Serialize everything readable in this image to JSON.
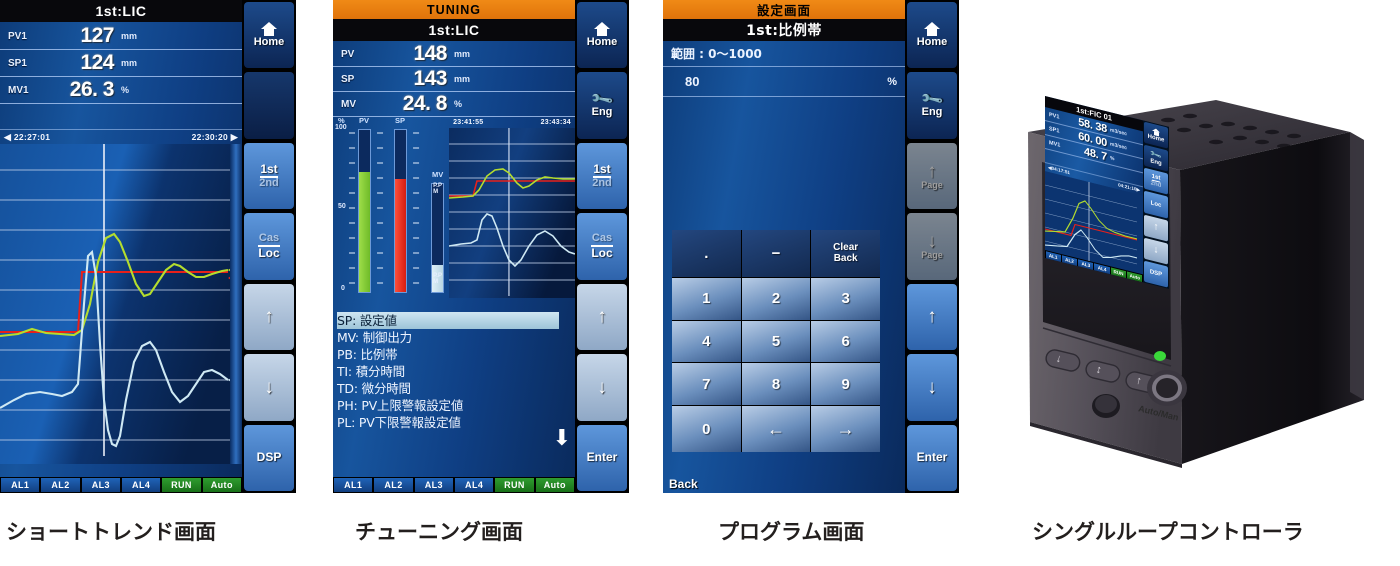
{
  "panels": [
    {
      "caption": "ショートトレンド画面",
      "header": {
        "title": "1st:LIC"
      },
      "values": [
        {
          "tag": "PV1",
          "value": "127",
          "unit": "mm"
        },
        {
          "tag": "SP1",
          "value": "124",
          "unit": "mm"
        },
        {
          "tag": "MV1",
          "value": "26. 3",
          "unit": "%"
        }
      ],
      "trend": {
        "time_start": "22:27:01",
        "time_end": "22:30:20",
        "markers": [
          {
            "label": "PV1",
            "color": "#b4dd2e"
          },
          {
            "label": "SP1",
            "color": "#e8201a"
          },
          {
            "label": "MV1",
            "color": "#cfe9f4"
          }
        ]
      },
      "side_buttons": [
        {
          "id": "home",
          "label": "Home",
          "icon": "house-icon",
          "style": "dark"
        },
        {
          "id": "blank",
          "label": "",
          "style": "blank"
        },
        {
          "id": "loop",
          "label": "1st",
          "sub": "2nd",
          "style": "mid"
        },
        {
          "id": "cascade",
          "label": "Cas",
          "sub": "Loc",
          "style": "mid"
        },
        {
          "id": "up",
          "label": "",
          "icon": "arrow-up-icon",
          "style": "light"
        },
        {
          "id": "down",
          "label": "",
          "icon": "arrow-down-icon",
          "style": "light"
        },
        {
          "id": "dsp",
          "label": "DSP",
          "style": "mid"
        }
      ],
      "status": [
        {
          "label": "AL1",
          "color": "blue"
        },
        {
          "label": "AL2",
          "color": "blue"
        },
        {
          "label": "AL3",
          "color": "blue"
        },
        {
          "label": "AL4",
          "color": "blue"
        },
        {
          "label": "RUN",
          "color": "green"
        },
        {
          "label": "Auto",
          "color": "green"
        }
      ]
    },
    {
      "caption": "チューニング画面",
      "header": {
        "mode": "TUNING",
        "title": "1st:LIC"
      },
      "values": [
        {
          "tag": "PV",
          "value": "148",
          "unit": "mm"
        },
        {
          "tag": "SP",
          "value": "143",
          "unit": "mm"
        },
        {
          "tag": "MV",
          "value": "24. 8",
          "unit": "%"
        }
      ],
      "bargraph": {
        "unit": "%",
        "scale_top": "100",
        "scale_mid": "50",
        "scale_bottom": "0",
        "bars": [
          {
            "label": "PV",
            "pct": 74,
            "color": "green"
          },
          {
            "label": "SP",
            "pct": 70,
            "color": "red"
          },
          {
            "label": "MV",
            "pct": 25,
            "color": "pale"
          }
        ]
      },
      "trend": {
        "time_start": "23:41:55",
        "time_end": "23:43:34"
      },
      "param_list": [
        {
          "code": "SP:",
          "name": "設定値",
          "selected": true
        },
        {
          "code": "MV:",
          "name": "制御出力",
          "selected": false
        },
        {
          "code": "PB:",
          "name": "比例帯",
          "selected": false
        },
        {
          "code": "TI:",
          "name": "積分時間",
          "selected": false
        },
        {
          "code": "TD:",
          "name": "微分時間",
          "selected": false
        },
        {
          "code": "PH:",
          "name": "PV上限警報設定値",
          "selected": false
        },
        {
          "code": "PL:",
          "name": "PV下限警報設定値",
          "selected": false
        }
      ],
      "side_buttons": [
        {
          "id": "home",
          "label": "Home",
          "icon": "house-icon",
          "style": "dark"
        },
        {
          "id": "eng",
          "label": "Eng",
          "icon": "wrench-icon",
          "style": "dark"
        },
        {
          "id": "loop",
          "label": "1st",
          "sub": "2nd",
          "style": "mid"
        },
        {
          "id": "cascade",
          "label": "Cas",
          "sub": "Loc",
          "style": "mid"
        },
        {
          "id": "up",
          "label": "",
          "icon": "arrow-up-icon",
          "style": "light"
        },
        {
          "id": "down",
          "label": "",
          "icon": "arrow-down-icon",
          "style": "light"
        },
        {
          "id": "enter",
          "label": "Enter",
          "style": "mid"
        }
      ],
      "status": [
        {
          "label": "AL1",
          "color": "blue"
        },
        {
          "label": "AL2",
          "color": "blue"
        },
        {
          "label": "AL3",
          "color": "blue"
        },
        {
          "label": "AL4",
          "color": "blue"
        },
        {
          "label": "RUN",
          "color": "green"
        },
        {
          "label": "Auto",
          "color": "green"
        }
      ]
    },
    {
      "caption": "プログラム画面",
      "header": {
        "mode": "設定画面",
        "title": "1st:比例帯"
      },
      "range_label": "範囲 : 0〜1000",
      "entry": {
        "value": "80",
        "unit": "%"
      },
      "keypad": [
        {
          "label": ".",
          "style": "dark"
        },
        {
          "label": "−",
          "style": "dark"
        },
        {
          "label": "Clear\nBack",
          "style": "dark",
          "small": true
        },
        {
          "label": "1",
          "style": "light"
        },
        {
          "label": "2",
          "style": "light"
        },
        {
          "label": "3",
          "style": "light"
        },
        {
          "label": "4",
          "style": "light"
        },
        {
          "label": "5",
          "style": "light"
        },
        {
          "label": "6",
          "style": "light"
        },
        {
          "label": "7",
          "style": "light"
        },
        {
          "label": "8",
          "style": "light"
        },
        {
          "label": "9",
          "style": "light"
        },
        {
          "label": "0",
          "style": "light"
        },
        {
          "label": "←",
          "style": "light",
          "arrow": true
        },
        {
          "label": "→",
          "style": "light",
          "arrow": true
        }
      ],
      "back_label": "Back",
      "side_buttons": [
        {
          "id": "home",
          "label": "Home",
          "icon": "house-icon",
          "style": "dark"
        },
        {
          "id": "eng",
          "label": "Eng",
          "icon": "wrench-icon",
          "style": "dark"
        },
        {
          "id": "page-up",
          "label": "Page",
          "icon": "arrow-up-icon",
          "style": "light",
          "dimmed": true
        },
        {
          "id": "page-down",
          "label": "Page",
          "icon": "arrow-down-icon",
          "style": "light",
          "dimmed": true
        },
        {
          "id": "up",
          "label": "",
          "icon": "arrow-up-icon",
          "style": "mid"
        },
        {
          "id": "down",
          "label": "",
          "icon": "arrow-down-icon",
          "style": "mid"
        },
        {
          "id": "enter",
          "label": "Enter",
          "style": "mid"
        }
      ]
    }
  ],
  "device": {
    "caption": "シングルループコントローラ",
    "screen": {
      "header": "1st:FIC 01",
      "values": [
        {
          "tag": "PV1",
          "value": "58. 38",
          "unit": "m3/sec"
        },
        {
          "tag": "SP1",
          "value": "60. 00",
          "unit": "m3/sec"
        },
        {
          "tag": "MV1",
          "value": "48. 7",
          "unit": "%"
        }
      ],
      "trend": {
        "time_start": "04:17:51",
        "time_end": "04:21:10"
      },
      "side_buttons": [
        {
          "id": "home",
          "label": "Home",
          "icon": "house-icon",
          "style": "dark"
        },
        {
          "id": "eng",
          "label": "Eng",
          "icon": "wrench-icon",
          "style": "dark"
        },
        {
          "id": "loop",
          "label": "1st",
          "sub": "2nd",
          "style": "mid"
        },
        {
          "id": "cascade",
          "label": "Loc",
          "style": "mid"
        },
        {
          "id": "up",
          "label": "",
          "icon": "arrow-up-icon",
          "style": "light"
        },
        {
          "id": "down",
          "label": "",
          "icon": "arrow-down-icon",
          "style": "light"
        },
        {
          "id": "dsp",
          "label": "DSP",
          "style": "mid"
        }
      ],
      "status": [
        {
          "label": "AL1",
          "color": "blue"
        },
        {
          "label": "AL2",
          "color": "blue"
        },
        {
          "label": "AL3",
          "color": "blue"
        },
        {
          "label": "AL4",
          "color": "blue"
        },
        {
          "label": "RUN",
          "color": "green"
        },
        {
          "label": "Auto",
          "color": "green"
        }
      ]
    },
    "front_buttons": [
      {
        "id": "down",
        "glyph": "↓"
      },
      {
        "id": "updown",
        "glyph": "↕"
      },
      {
        "id": "up",
        "glyph": "↑"
      }
    ],
    "knob_label": "Auto/Man"
  },
  "colors": {
    "accent_orange": "#ef8a14",
    "pv_green": "#b4dd2e",
    "sp_red": "#e8201a",
    "mv_cyan": "#cfe9f4",
    "screen_blue": "#15539c",
    "status_green": "#2f9c2f"
  }
}
